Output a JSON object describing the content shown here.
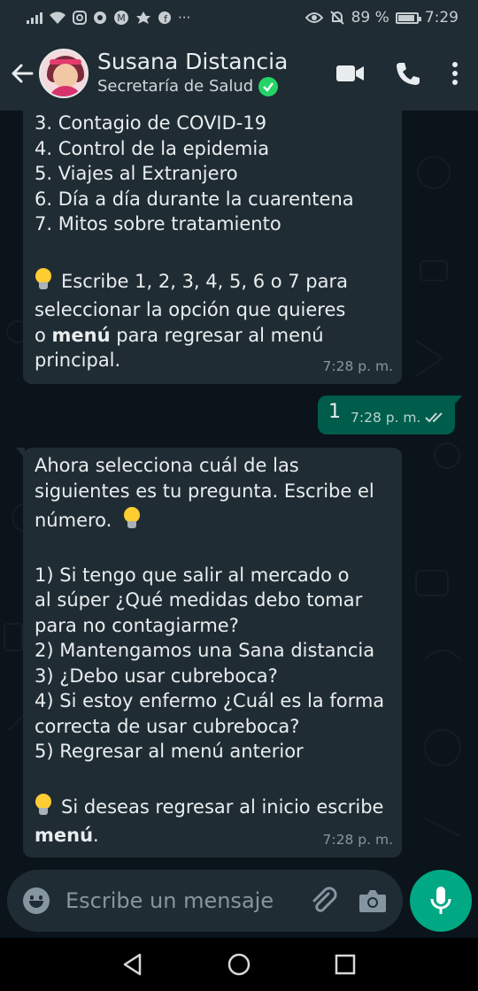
{
  "status_bar": {
    "battery": "89 %",
    "battery_level": 0.89,
    "time": "7:29",
    "more": "···"
  },
  "header": {
    "contact_name": "Susana Distancia",
    "subtitle": "Secretaría de Salud",
    "icons": [
      "back-arrow-icon",
      "video-call-icon",
      "phone-icon",
      "more-vert-icon"
    ]
  },
  "messages": {
    "m1": {
      "lines": [
        "3. Contagio de COVID-19",
        "4. Control de la epidemia",
        "5. Viajes al Extranjero",
        "6. Día a día durante la cuarentena",
        "7. Mitos sobre tratamiento"
      ],
      "instr_line1": "Escribe 1, 2, 3, 4, 5, 6 o 7 para",
      "instr_line2": "seleccionar la opción que quieres",
      "instr_line3_a": "o ",
      "instr_line3_bold": "menú",
      "instr_line3_b": " para regresar al menú",
      "instr_line4": "principal.",
      "time": "7:28 p. m."
    },
    "m2": {
      "text": "1",
      "time": "7:28 p. m.",
      "status": "read"
    },
    "m3": {
      "intro1": "Ahora selecciona cuál de las",
      "intro2": "siguientes es tu pregunta. Escribe el",
      "intro3": "número.",
      "o1_num": "1)",
      "o1_a": " Si tengo que salir al mercado o",
      "o1_b": "al súper ¿Qué medidas debo tomar",
      "o1_c": "para no contagiarme?",
      "o2_num": "2)",
      "o2": " Mantengamos una Sana distancia",
      "o3_num": "3)",
      "o3": " ¿Debo usar cubreboca?",
      "o4_num": "4)",
      "o4_a": " Si estoy enfermo ¿Cuál es la forma",
      "o4_b": "correcta de usar cubreboca?",
      "o5_num": "5)",
      "o5": " Regresar al menú anterior",
      "end1": "Si deseas regresar al inicio escribe",
      "end2_bold": "menú",
      "end2": ".",
      "time": "7:28 p. m."
    }
  },
  "input": {
    "placeholder": "Escribe un mensaje"
  },
  "colors": {
    "header_bg": "#1f2c33",
    "incoming": "#202c33",
    "outgoing": "#005c4b",
    "accent": "#00a884"
  }
}
